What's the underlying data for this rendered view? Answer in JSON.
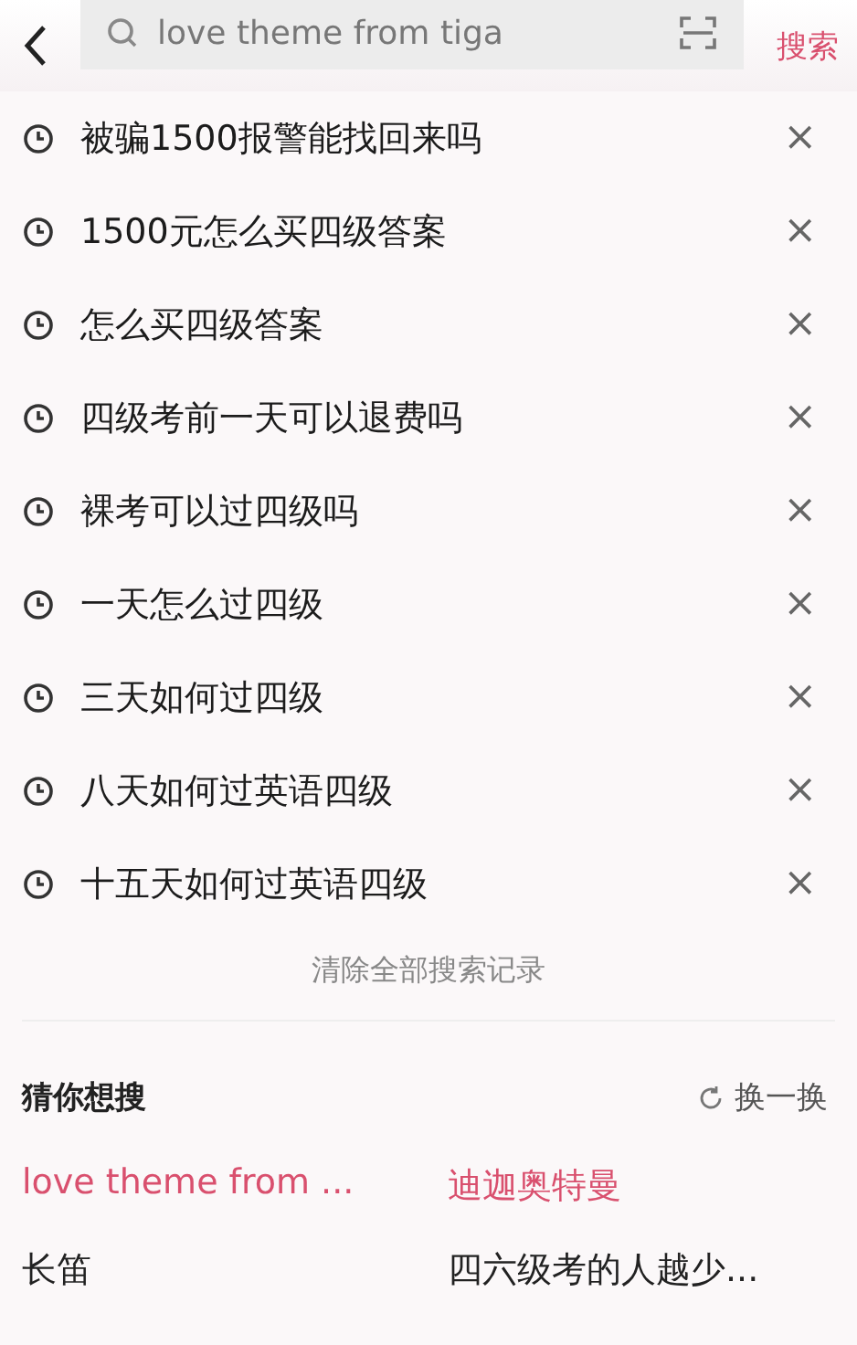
{
  "search": {
    "value": "love theme from tiga",
    "button": "搜索"
  },
  "history": [
    {
      "text": "被骗1500报警能找回来吗",
      "close": "×"
    },
    {
      "text": "1500元怎么买四级答案",
      "close": "×"
    },
    {
      "text": "怎么买四级答案",
      "close": "×"
    },
    {
      "text": "四级考前一天可以退费吗",
      "close": "×"
    },
    {
      "text": "裸考可以过四级吗",
      "close": "×"
    },
    {
      "text": "一天怎么过四级",
      "close": "×"
    },
    {
      "text": "三天如何过四级",
      "close": "×"
    },
    {
      "text": "八天如何过英语四级",
      "close": "×"
    },
    {
      "text": "十五天如何过英语四级",
      "close": "×"
    }
  ],
  "clear_history": "清除全部搜索记录",
  "suggestions": {
    "title": "猜你想搜",
    "refresh": "换一换",
    "items": [
      {
        "text": "love theme from ...",
        "highlighted": true
      },
      {
        "text": "迪迦奥特曼",
        "highlighted": true
      },
      {
        "text": "长笛",
        "highlighted": false
      },
      {
        "text": "四六级考的人越少...",
        "highlighted": false
      }
    ]
  }
}
